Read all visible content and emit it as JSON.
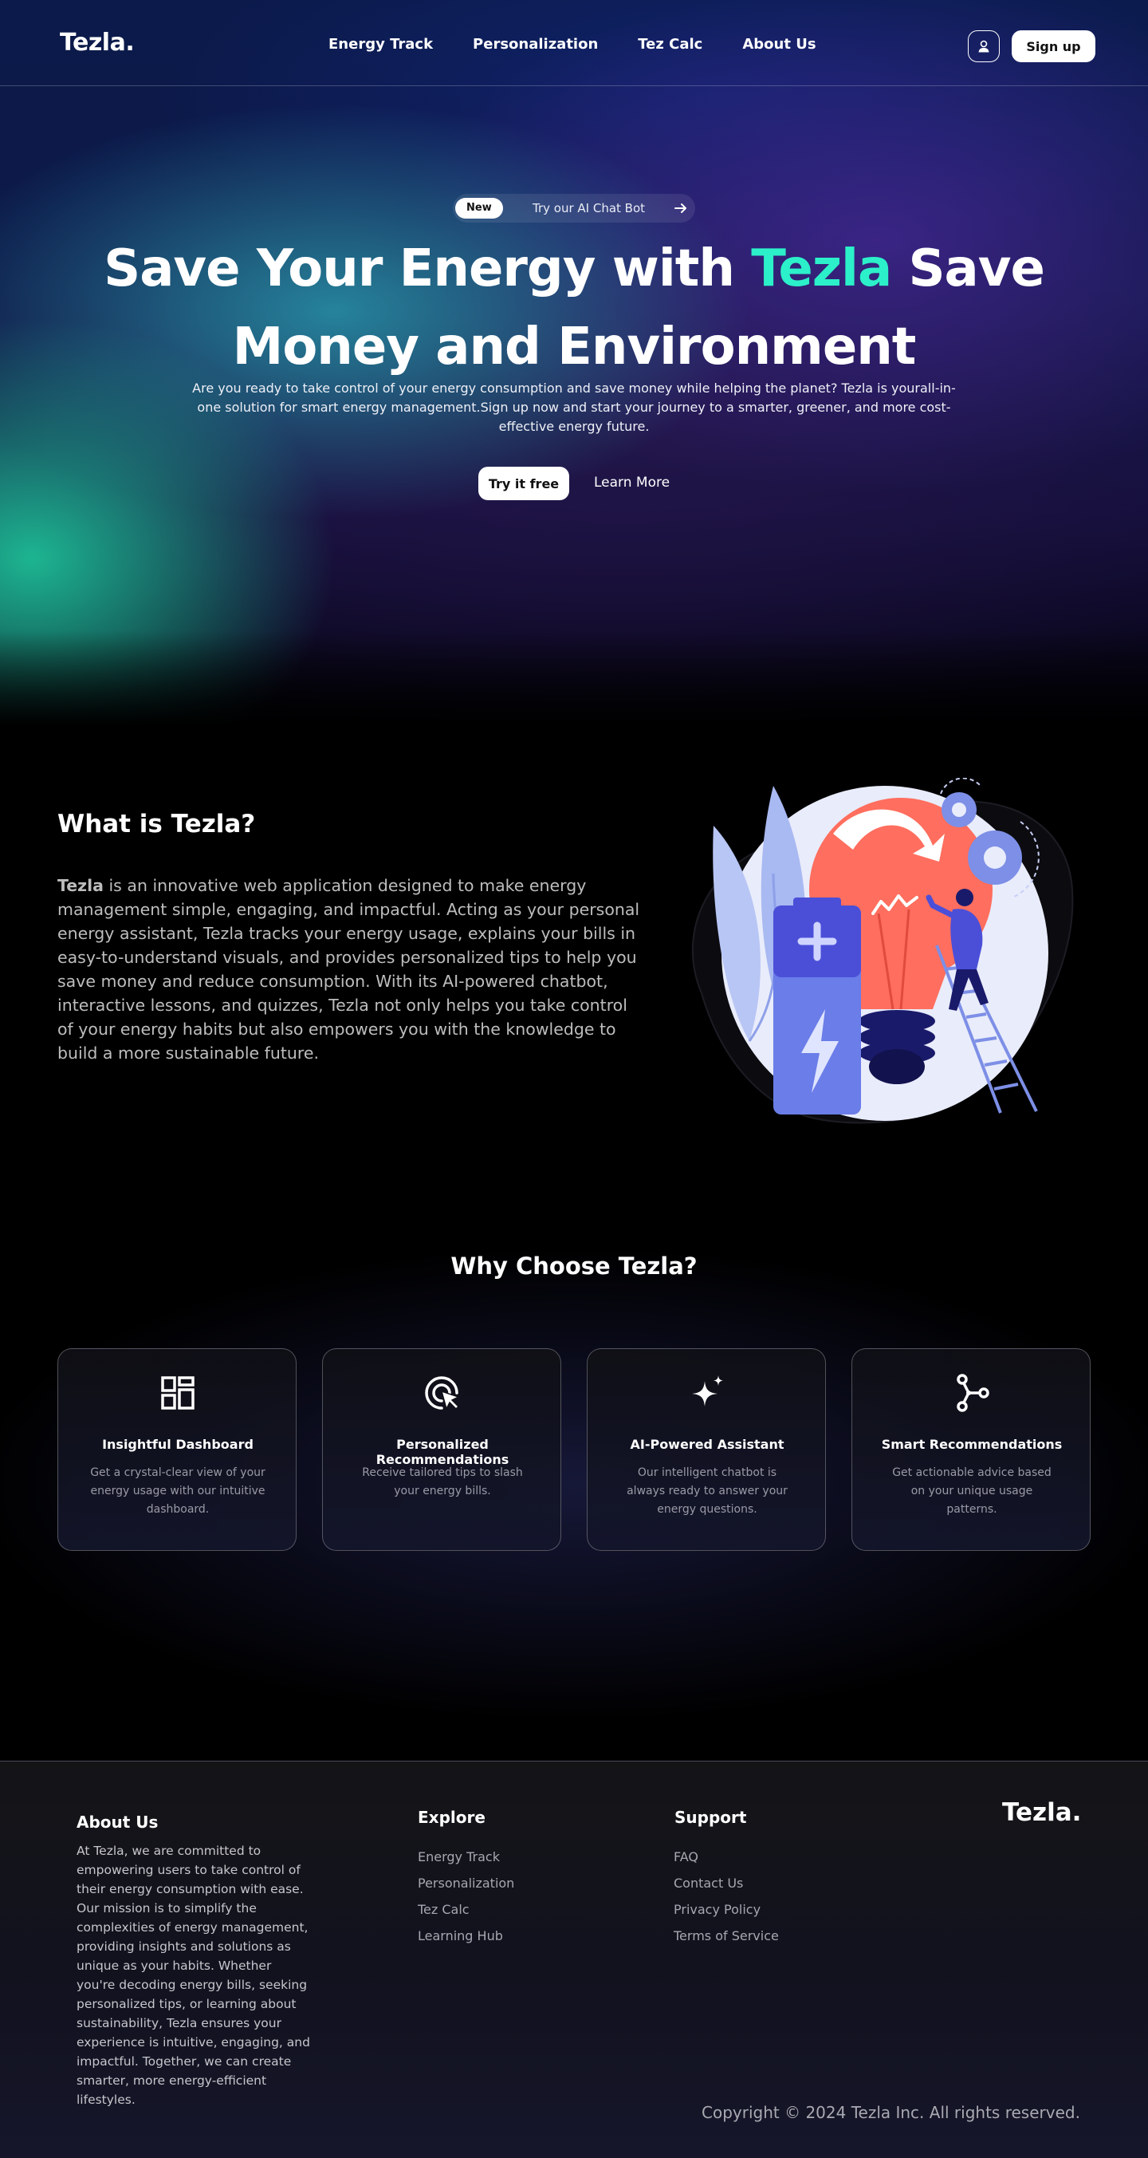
{
  "nav": {
    "logo": "Tezla.",
    "links": [
      "Energy Track",
      "Personalization",
      "Tez Calc",
      "About Us"
    ],
    "user_icon": "user-icon",
    "signup_label": "Sign up"
  },
  "hero": {
    "badge": "New",
    "pill_text": "Try our AI Chat Bot",
    "pill_icon": "arrow-right-icon",
    "title_part1": "Save Your Energy with ",
    "title_accent": "Tezla",
    "title_part2": " Save Money and Environment",
    "accent_color": "#2cf0c9",
    "description": "Are you ready to take control of your energy consumption and save money while helping the planet? Tezla is yourall-in-one solution for smart energy management.Sign up now and start your journey to a smarter, greener, and more cost-effective energy future.",
    "primary_cta": "Try it free",
    "secondary_cta": "Learn More"
  },
  "about": {
    "title": "What is Tezla?",
    "brand": "Tezla",
    "body": " is an innovative web application designed to make energy management simple, engaging, and impactful. Acting as your personal energy assistant, Tezla tracks your energy usage, explains your bills in easy-to-understand visuals, and provides personalized tips to help you save money and reduce consumption. With its AI-powered chatbot, interactive lessons, and quizzes, Tezla not only helps you take control of your energy habits but also empowers you with the knowledge to build a more sustainable future."
  },
  "why": {
    "title": "Why Choose Tezla?",
    "cards": [
      {
        "icon": "dashboard-icon",
        "title": "Insightful Dashboard",
        "desc": "Get a crystal-clear view of your energy usage with our intuitive dashboard."
      },
      {
        "icon": "target-cursor-icon",
        "title": "Personalized Recommendations",
        "desc": "Receive tailored tips to slash your energy bills."
      },
      {
        "icon": "sparkle-icon",
        "title": "AI-Powered Assistant",
        "desc": "Our intelligent chatbot is always ready to answer your energy questions."
      },
      {
        "icon": "network-icon",
        "title": "Smart Recommendations",
        "desc": "Get actionable advice based on your unique usage patterns."
      }
    ]
  },
  "footer": {
    "about_title": "About Us",
    "about_text": "At Tezla, we are committed to empowering users to take control of their energy consumption with ease. Our mission is to simplify the complexities of energy management, providing insights and solutions as unique as your habits. Whether you're decoding energy bills, seeking personalized tips, or learning about sustainability, Tezla ensures your experience is intuitive, engaging, and impactful. Together, we can create smarter, more energy-efficient lifestyles.",
    "explore_title": "Explore",
    "explore_links": [
      "Energy Track",
      "Personalization",
      "Tez Calc",
      "Learning Hub"
    ],
    "support_title": "Support",
    "support_links": [
      "FAQ",
      "Contact Us",
      "Privacy Policy",
      "Terms of Service"
    ],
    "logo": "Tezla.",
    "copyright": "Copyright © 2024 Tezla Inc. All rights reserved."
  }
}
